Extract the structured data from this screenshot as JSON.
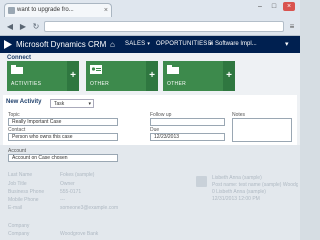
{
  "browser": {
    "tab_title": "want to upgrade fro...",
    "icons": [
      "favicon",
      "back-arrow-icon",
      "forward-arrow-icon",
      "menu-icon"
    ]
  },
  "crm": {
    "title": "Microsoft Dynamics CRM",
    "nav": [
      {
        "label": "SALES"
      },
      {
        "label": "OPPORTUNITIES"
      }
    ],
    "record": "Bi Software Impl..."
  },
  "connect": {
    "title": "Connect",
    "tiles": [
      {
        "label": "ACTIVITIES",
        "plus": "+"
      },
      {
        "label": "OTHER",
        "plus": "+"
      },
      {
        "label": "OTHER",
        "plus": "+"
      }
    ]
  },
  "new_activity": {
    "title": "New Activity",
    "type_value": "Task",
    "fields": {
      "topic": {
        "label": "Topic",
        "value": "Really Important Case"
      },
      "contact": {
        "label": "Contact",
        "value": "Person who owns this case"
      },
      "account": {
        "label": "Account",
        "value": "Account on Case chosen"
      },
      "follow_up": {
        "label": "Follow up",
        "value": ""
      },
      "due": {
        "label": "Due",
        "value": "12/23/2013"
      },
      "notes": {
        "label": "Notes",
        "value": ""
      }
    }
  },
  "background": {
    "rows": [
      {
        "label": "Last Name",
        "value": "Fokes (sample)"
      },
      {
        "label": "Job Title",
        "value": "Owner"
      },
      {
        "label": "Business Phone",
        "value": "555-0171"
      },
      {
        "label": "Mobile Phone",
        "value": "---"
      },
      {
        "label": "E-mail",
        "value": "someone3@example.com"
      },
      {
        "label": "Company",
        "value": ""
      },
      {
        "label": "Company",
        "value": "Woodgrove Bank"
      }
    ],
    "post_name": "Lisbeth Anna (sample)",
    "post_line1": "Post name: test name (sample) Woodgrove...",
    "post_line2": "0 Lisbeth Anna (sample)",
    "post_date": "12/31/2013 12:00 PM"
  }
}
